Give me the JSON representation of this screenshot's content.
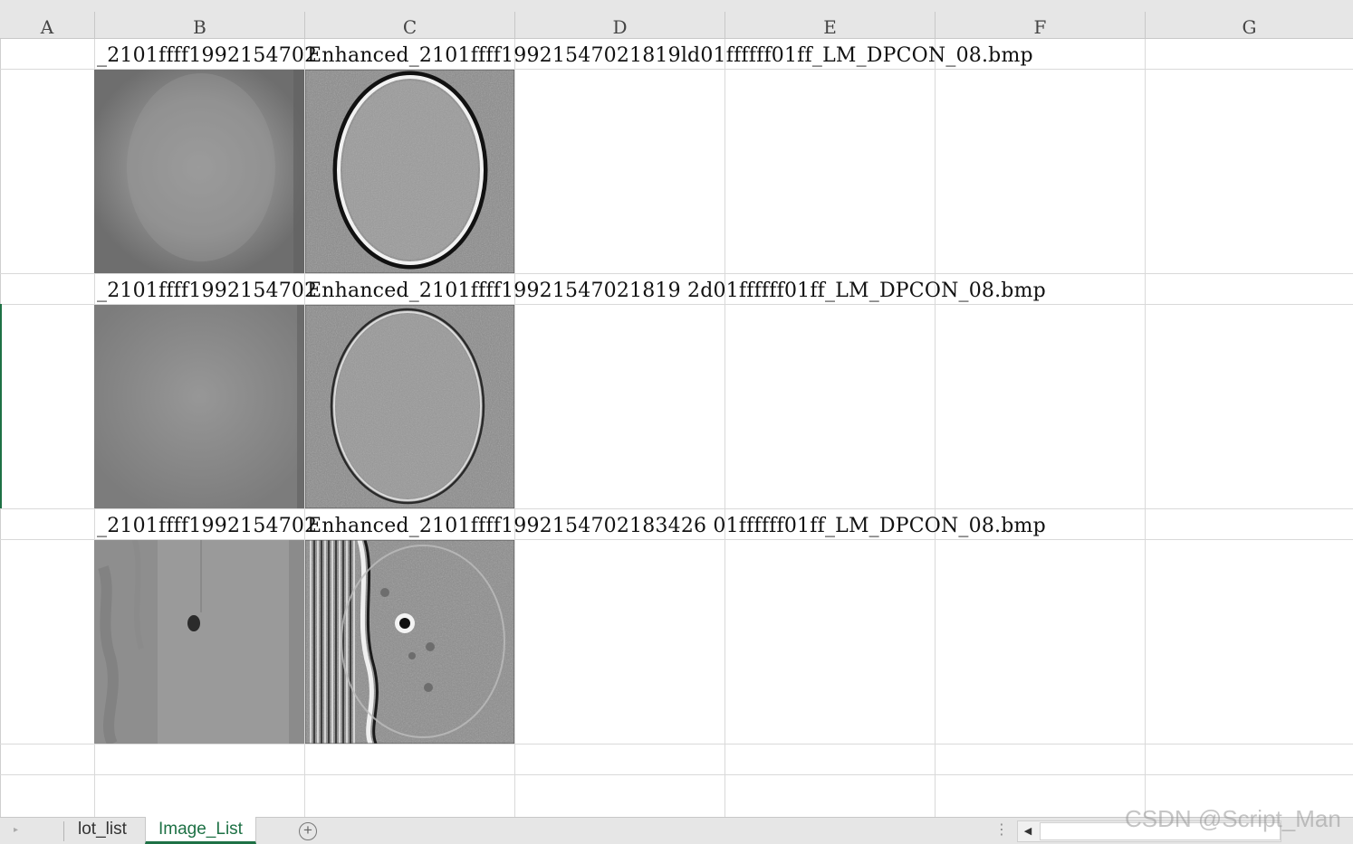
{
  "columns": [
    "A",
    "B",
    "C",
    "D",
    "E",
    "F",
    "G"
  ],
  "rows": [
    {
      "col_b_text": "_2101ffff1992154702",
      "col_c_text": "Enhanced_2101ffff19921547021819ld01ffffff01ff_LM_DPCON_08.bmp"
    },
    {
      "col_b_text": "_2101ffff1992154702",
      "col_c_text": "Enhanced_2101ffff19921547021819 2d01ffffff01ff_LM_DPCON_08.bmp"
    },
    {
      "col_b_text": "_2101ffff1992154702",
      "col_c_text": "Enhanced_2101ffff1992154702183426 01ffffff01ff_LM_DPCON_08.bmp"
    }
  ],
  "sheet_tabs": [
    {
      "label": "lot_list",
      "active": false
    },
    {
      "label": "Image_List",
      "active": true
    }
  ],
  "add_sheet_symbol": "+",
  "nav_symbol": "▸",
  "scroll_left_symbol": "◀",
  "more_symbol": "⋮",
  "watermark": "CSDN @Script_Man",
  "colors": {
    "accent": "#1e7145",
    "header_bg": "#e6e6e6",
    "grid": "#d9d9d9"
  },
  "icons": {
    "add_sheet": "add-circle-icon",
    "scroll_left": "triangle-left-icon",
    "more": "vertical-dots-icon"
  }
}
